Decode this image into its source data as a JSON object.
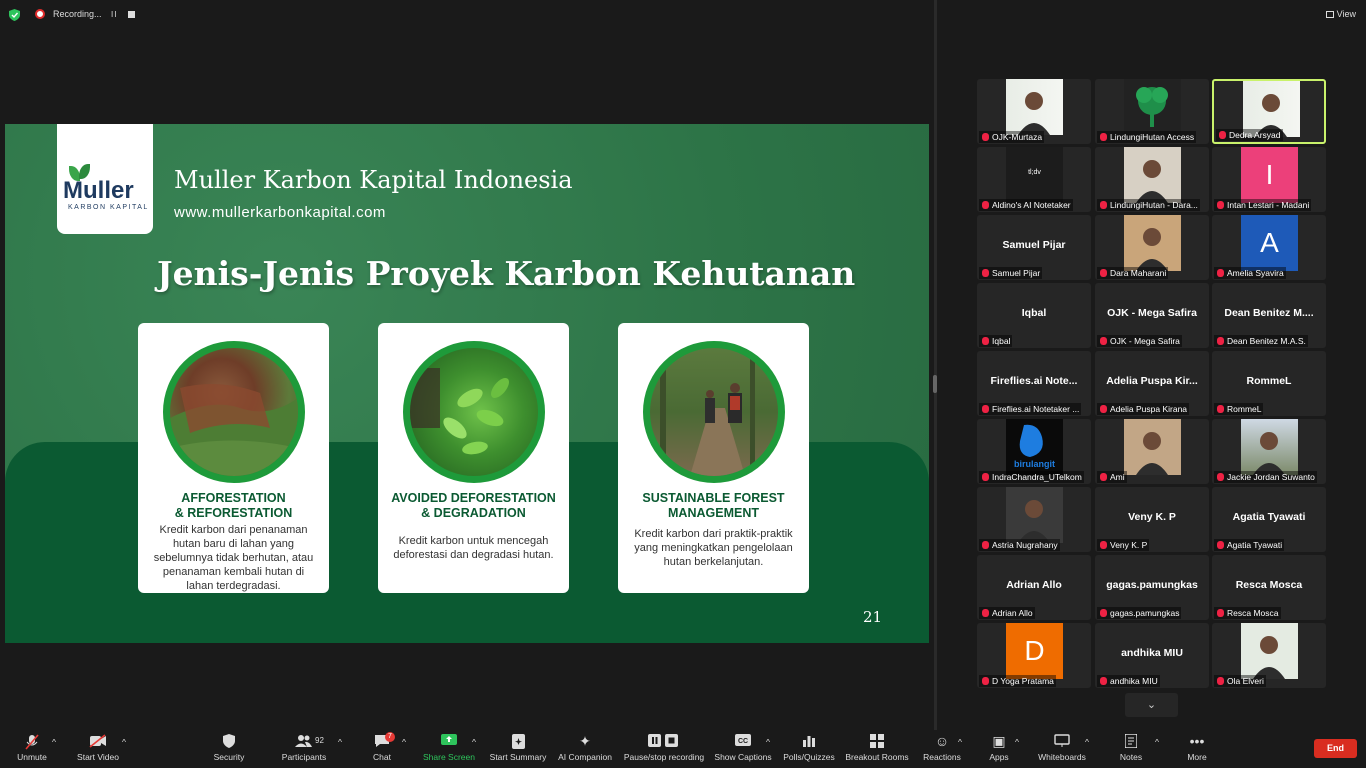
{
  "topbar": {
    "recording_label": "Recording...",
    "pause_glyph": "II",
    "view_label": "View"
  },
  "slide": {
    "logo_name": "Muller",
    "logo_sub": "KARBON KAPITAL",
    "org_name": "Muller Karbon Kapital Indonesia",
    "org_url": "www.mullerkarbonkapital.com",
    "title": "Jenis-Jenis Proyek Karbon Kehutanan",
    "page_number": "21",
    "cards": [
      {
        "title_1": "AFFORESTATION",
        "title_2": "& REFORESTATION",
        "desc": "Kredit karbon dari penanaman hutan baru di lahan yang sebelumnya tidak berhutan, atau penanaman kembali hutan di lahan terdegradasi."
      },
      {
        "title_1": "AVOIDED DEFORESTATION",
        "title_2": "& DEGRADATION",
        "desc": "Kredit karbon untuk mencegah deforestasi dan degradasi hutan."
      },
      {
        "title_1": "SUSTAINABLE FOREST",
        "title_2": "MANAGEMENT",
        "desc": "Kredit karbon dari praktik-praktik yang meningkatkan pengelolaan hutan berkelanjutan."
      }
    ]
  },
  "participants": [
    {
      "label": "OJK-Murtaza",
      "big": ""
    },
    {
      "label": "LindungiHutan Access",
      "big": ""
    },
    {
      "label": "Dedra Arsyad",
      "big": ""
    },
    {
      "label": "Aldino's AI Notetaker",
      "big": "tl;dv"
    },
    {
      "label": "LindungiHutan - Dara...",
      "big": ""
    },
    {
      "label": "Intan Lestari - Madani",
      "big": "I"
    },
    {
      "label": "Samuel Pijar",
      "big": "Samuel Pijar"
    },
    {
      "label": "Dara Maharani",
      "big": ""
    },
    {
      "label": "Amelia Syavira",
      "big": "A"
    },
    {
      "label": "Iqbal",
      "big": "Iqbal"
    },
    {
      "label": "OJK - Mega Safira",
      "big": "OJK - Mega Safira"
    },
    {
      "label": "Dean Benitez M.A.S.",
      "big": "Dean Benitez M...."
    },
    {
      "label": "Fireflies.ai Notetaker ...",
      "big": "Fireflies.ai  Note..."
    },
    {
      "label": "Adelia Puspa Kirana",
      "big": "Adelia Puspa Kir..."
    },
    {
      "label": "RommeL",
      "big": "RommeL"
    },
    {
      "label": "IndraChandra_UTelkom",
      "big": "birulangit"
    },
    {
      "label": "Ami",
      "big": ""
    },
    {
      "label": "Jackie Jordan Suwanto",
      "big": ""
    },
    {
      "label": "Astria Nugrahany",
      "big": ""
    },
    {
      "label": "Veny K. P",
      "big": "Veny K. P"
    },
    {
      "label": "Agatia Tyawati",
      "big": "Agatia Tyawati"
    },
    {
      "label": "Adrian Allo",
      "big": "Adrian Allo"
    },
    {
      "label": "gagas.pamungkas",
      "big": "gagas.pamungkas"
    },
    {
      "label": "Resca Mosca",
      "big": "Resca Mosca"
    },
    {
      "label": "D Yoga Pratama",
      "big": "D"
    },
    {
      "label": "andhika MIU",
      "big": "andhika MIU"
    },
    {
      "label": "Ola Elveri",
      "big": ""
    }
  ],
  "toolbar": {
    "unmute": "Unmute",
    "start_video": "Start Video",
    "security": "Security",
    "participants": "Participants",
    "participants_count": "92",
    "chat": "Chat",
    "chat_badge": "7",
    "share_screen": "Share Screen",
    "start_summary": "Start Summary",
    "ai_companion": "AI Companion",
    "pause_recording": "Pause/stop recording",
    "show_captions": "Show Captions",
    "polls": "Polls/Quizzes",
    "breakout": "Breakout Rooms",
    "reactions": "Reactions",
    "apps": "Apps",
    "whiteboards": "Whiteboards",
    "notes": "Notes",
    "more": "More",
    "end": "End"
  },
  "colors": {
    "slide_green": "#2f7a4b",
    "slide_dark_green": "#0b5a32",
    "card_title": "#0b5a32",
    "active_speaker": "#c9f26b",
    "end_button": "#d92d20",
    "share_green": "#2ec45c"
  }
}
